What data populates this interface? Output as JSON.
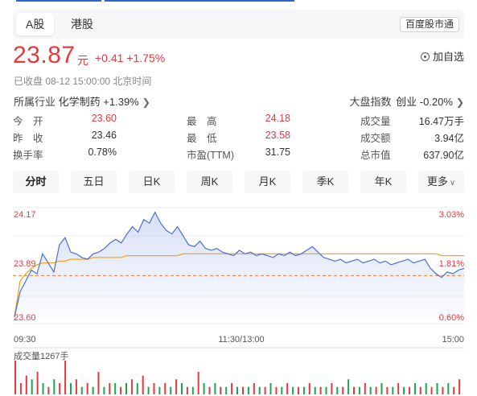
{
  "tabs": [
    {
      "label": "A股",
      "active": true
    },
    {
      "label": "港股",
      "active": false
    }
  ],
  "badge": "百度股市通",
  "quote": {
    "price": "23.87",
    "unit": "元",
    "change": "+0.41 +1.75%",
    "color": "#e9383b"
  },
  "add_watch": "加自选",
  "status": "已收盘  08-12 15:00:00  北京时间",
  "industry": {
    "prefix": "所属行业",
    "name": "化学制药",
    "change": "+1.39%"
  },
  "index": {
    "label": "大盘指数",
    "board": "创业",
    "change": "-0.20%"
  },
  "stats": [
    [
      {
        "label": "今　开",
        "value": "23.60",
        "tone": "red"
      },
      {
        "label": "最　高",
        "value": "24.18",
        "tone": "red"
      },
      {
        "label": "成交量",
        "value": "16.47万手",
        "tone": "dark"
      }
    ],
    [
      {
        "label": "昨　收",
        "value": "23.46",
        "tone": "dark"
      },
      {
        "label": "最　低",
        "value": "23.58",
        "tone": "red"
      },
      {
        "label": "成交额",
        "value": "3.94亿",
        "tone": "dark"
      }
    ],
    [
      {
        "label": "换手率",
        "value": "0.78%",
        "tone": "dark"
      },
      {
        "label": "市盈(TTM)",
        "value": "31.75",
        "tone": "dark"
      },
      {
        "label": "总市值",
        "value": "637.90亿",
        "tone": "dark"
      }
    ]
  ],
  "periods": [
    "分时",
    "五日",
    "日K",
    "周K",
    "月K",
    "季K",
    "年K",
    "更多"
  ],
  "active_period": "分时",
  "chart_data": {
    "type": "line",
    "y_left_ticks": [
      "24.17",
      "23.89",
      "23.60"
    ],
    "y_right_ticks": [
      "3.03%",
      "1.81%",
      "0.60%"
    ],
    "x_ticks": [
      "09:30",
      "11:30/13:00",
      "15:00"
    ],
    "ylim": [
      23.6,
      24.17
    ],
    "prev_close": 23.46,
    "colors": {
      "price": "#4a6fd4",
      "average": "#f5a623",
      "baseline": "#f07a3a",
      "up": "#e9383b",
      "down": "#1aa84e"
    },
    "price_series": [
      23.6,
      23.74,
      23.8,
      23.86,
      23.84,
      23.95,
      23.9,
      23.85,
      24.0,
      24.04,
      23.96,
      23.95,
      23.93,
      23.92,
      23.95,
      23.96,
      23.98,
      24.01,
      24.03,
      24.01,
      24.06,
      24.1,
      24.07,
      24.14,
      24.12,
      24.18,
      24.12,
      24.08,
      24.06,
      24.1,
      24.05,
      24.0,
      23.99,
      24.02,
      23.98,
      23.97,
      23.98,
      23.96,
      23.95,
      23.94,
      23.97,
      23.95,
      23.96,
      23.94,
      23.95,
      23.94,
      23.93,
      23.95,
      23.94,
      23.96,
      23.94,
      23.95,
      23.97,
      23.99,
      23.96,
      23.93,
      23.92,
      23.91,
      23.92,
      23.9,
      23.91,
      23.92,
      23.9,
      23.91,
      23.92,
      23.9,
      23.91,
      23.89,
      23.9,
      23.91,
      23.92,
      23.9,
      23.91,
      23.92,
      23.87,
      23.84,
      23.82,
      23.85,
      23.84,
      23.86,
      23.87
    ],
    "avg_series": [
      23.6,
      23.8,
      23.84,
      23.87,
      23.89,
      23.9,
      23.9,
      23.9,
      23.91,
      23.91,
      23.92,
      23.92,
      23.92,
      23.92,
      23.93,
      23.93,
      23.93,
      23.93,
      23.93,
      23.93,
      23.94,
      23.94,
      23.94,
      23.94,
      23.94,
      23.94,
      23.94,
      23.94,
      23.94,
      23.94,
      23.95,
      23.95,
      23.95,
      23.95,
      23.95,
      23.95,
      23.95,
      23.95,
      23.95,
      23.95,
      23.95,
      23.95,
      23.95,
      23.95,
      23.95,
      23.95,
      23.95,
      23.95,
      23.95,
      23.95,
      23.95,
      23.95,
      23.95,
      23.95,
      23.95,
      23.95,
      23.95,
      23.95,
      23.95,
      23.95,
      23.95,
      23.95,
      23.95,
      23.95,
      23.95,
      23.95,
      23.95,
      23.95,
      23.95,
      23.95,
      23.95,
      23.95,
      23.95,
      23.95,
      23.95,
      23.95,
      23.94,
      23.94,
      23.94,
      23.94,
      23.94
    ],
    "volume_label": "成交量1267手",
    "volume": [
      9,
      3,
      5,
      4,
      6,
      3,
      2,
      4,
      3,
      9,
      3,
      4,
      2,
      3,
      2,
      6,
      2,
      3,
      3,
      2,
      3,
      4,
      3,
      5,
      2,
      3,
      2,
      3,
      2,
      4,
      3,
      2,
      2,
      6,
      3,
      2,
      3,
      2,
      2,
      3,
      2,
      2,
      2,
      3,
      2,
      2,
      3,
      2,
      2,
      3,
      2,
      2,
      2,
      3,
      2,
      2,
      2,
      3,
      2,
      2,
      4,
      2,
      2,
      3,
      2,
      2,
      3,
      2,
      2,
      3,
      2,
      2,
      3,
      2,
      3,
      2,
      3,
      2,
      3,
      2,
      4
    ],
    "volume_dir": [
      "up",
      "up",
      "up",
      "down",
      "up",
      "down",
      "up",
      "down",
      "up",
      "up",
      "down",
      "up",
      "down",
      "up",
      "down",
      "up",
      "down",
      "up",
      "down",
      "up",
      "down",
      "up",
      "down",
      "up",
      "down",
      "up",
      "down",
      "up",
      "down",
      "up",
      "down",
      "up",
      "down",
      "up",
      "down",
      "up",
      "down",
      "up",
      "down",
      "up",
      "down",
      "up",
      "down",
      "up",
      "down",
      "up",
      "down",
      "up",
      "down",
      "up",
      "down",
      "up",
      "down",
      "up",
      "down",
      "up",
      "down",
      "up",
      "down",
      "up",
      "down",
      "up",
      "down",
      "up",
      "down",
      "up",
      "down",
      "up",
      "down",
      "up",
      "down",
      "up",
      "down",
      "up",
      "down",
      "up",
      "down",
      "up",
      "down",
      "up",
      "up"
    ]
  }
}
